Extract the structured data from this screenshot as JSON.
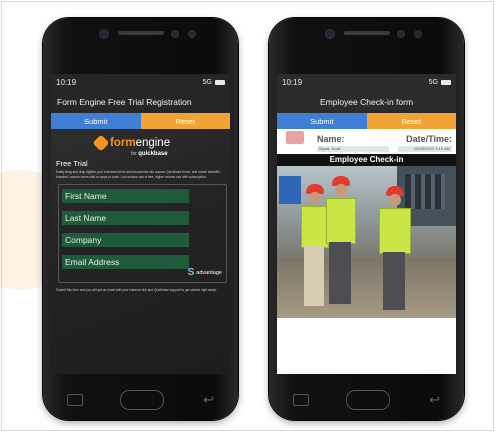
{
  "left_phone": {
    "status_time": "10:19",
    "status_network": "5G",
    "title": "Form Engine Free Trial Registration",
    "submit_label": "Submit",
    "reset_label": "Reset",
    "brand_name_1": "form",
    "brand_name_2": "engine",
    "brand_by": "for",
    "brand_qb": "quickbase",
    "section_title": "Free Trial",
    "description": "Easily drag and drop digitize your business forms and documents into custom Quickbase forms, and create beautiful, branded, custom forms with no apps or code. Low-volume use is free, higher volume use with subscription.",
    "fields": [
      "First Name",
      "Last Name",
      "Company",
      "Email Address"
    ],
    "partner_logo": "advantage",
    "footnote": "Submit this form and you will get an email with your instance link and Quickbase support to get started right away!"
  },
  "right_phone": {
    "status_time": "10:19",
    "status_network": "5G",
    "title": "Employee Check-in form",
    "submit_label": "Submit",
    "reset_label": "Reset",
    "name_label": "Name:",
    "name_value": "Wyatt, Scott",
    "date_label": "Date/Time:",
    "date_value": "03/25/2022 9:19 AM",
    "section_header": "Employee Check-in"
  },
  "colors": {
    "submit": "#3f7fd3",
    "reset": "#f2a335",
    "field_bg": "#1f5a3a",
    "brand_orange": "#f7931e"
  }
}
